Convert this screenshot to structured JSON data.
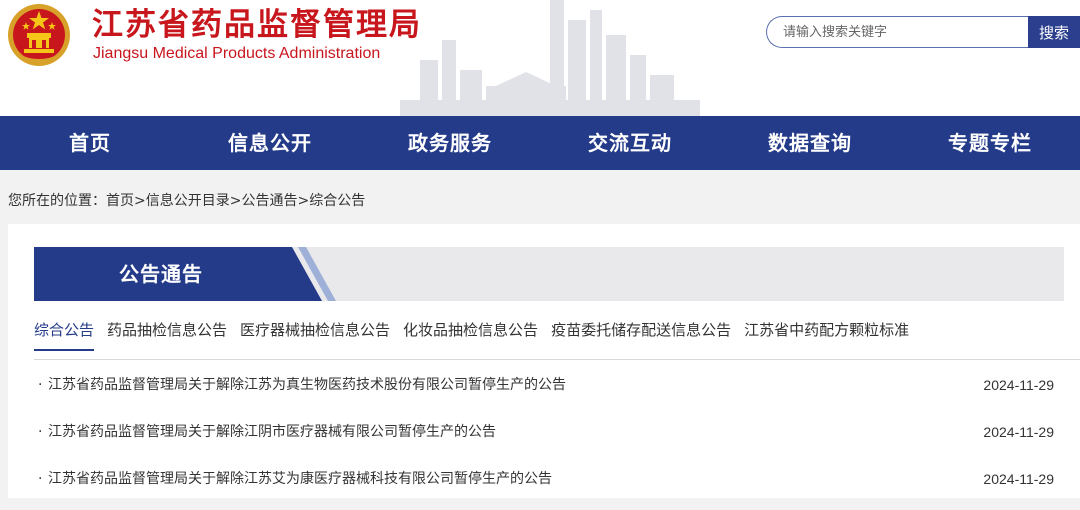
{
  "header": {
    "title_cn": "江苏省药品监督管理局",
    "title_en": "Jiangsu Medical Products Administration",
    "emblem_icon": "national-emblem-icon",
    "search_placeholder": "请输入搜索关键字",
    "search_button": "搜索",
    "brand_color": "#c8161d"
  },
  "nav": {
    "color": "#243b8a",
    "items": [
      "首页",
      "信息公开",
      "政务服务",
      "交流互动",
      "数据查询",
      "专题专栏"
    ]
  },
  "breadcrumb": {
    "prefix": "您所在的位置：",
    "items": [
      "首页",
      "信息公开目录",
      "公告通告",
      "综合公告"
    ],
    "separator": ">"
  },
  "section": {
    "title": "公告通告",
    "tabs": [
      "综合公告",
      "药品抽检信息公告",
      "医疗器械抽检信息公告",
      "化妆品抽检信息公告",
      "疫苗委托储存配送信息公告",
      "江苏省中药配方颗粒标准"
    ],
    "active_tab": "综合公告"
  },
  "list": [
    {
      "bullet": "·",
      "title": "江苏省药品监督管理局关于解除江苏为真生物医药技术股份有限公司暂停生产的公告",
      "date": "2024-11-29"
    },
    {
      "bullet": "·",
      "title": "江苏省药品监督管理局关于解除江阴市医疗器械有限公司暂停生产的公告",
      "date": "2024-11-29"
    },
    {
      "bullet": "·",
      "title": "江苏省药品监督管理局关于解除江苏艾为康医疗器械科技有限公司暂停生产的公告",
      "date": "2024-11-29"
    }
  ]
}
